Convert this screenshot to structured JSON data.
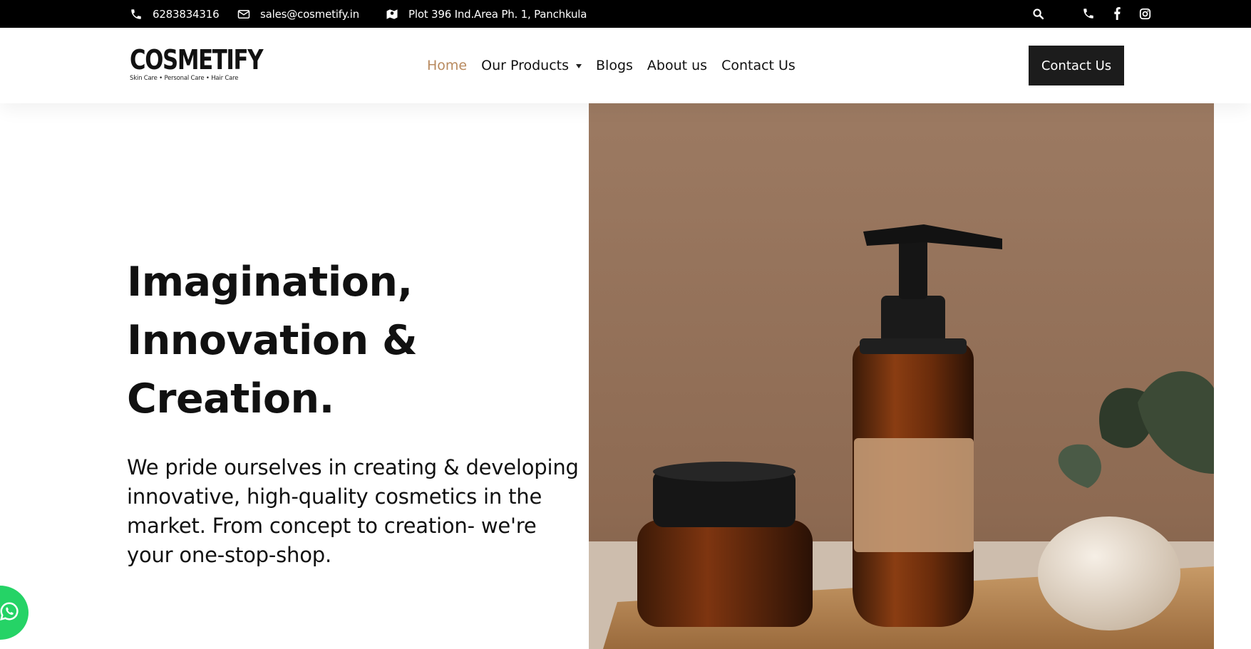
{
  "topbar": {
    "phone": "6283834316",
    "email": "sales@cosmetify.in",
    "address": "Plot 396 Ind.Area Ph. 1, Panchkula"
  },
  "header": {
    "logo_word": "COSMETIFY",
    "logo_tagline": "Skin Care • Personal Care • Hair Care",
    "nav": [
      {
        "label": "Home",
        "active": true
      },
      {
        "label": "Our Products",
        "dropdown": true
      },
      {
        "label": "Blogs"
      },
      {
        "label": "About us"
      },
      {
        "label": "Contact Us"
      }
    ],
    "cta_label": "Contact Us"
  },
  "hero": {
    "title_lines": [
      "Imagination,",
      "Innovation &",
      "Creation."
    ],
    "description": "We pride ourselves in creating & developing innovative, high-quality cosmetics in the market. From concept to creation- we're your one-stop-shop."
  },
  "colors": {
    "accent": "#b88a5f",
    "topbar_bg": "#000000",
    "cta_bg": "#1c1c1c",
    "whatsapp": "#25d366"
  },
  "icons": [
    "phone-icon",
    "mail-icon",
    "map-icon",
    "search-icon",
    "facebook-icon",
    "instagram-icon",
    "whatsapp-icon"
  ]
}
